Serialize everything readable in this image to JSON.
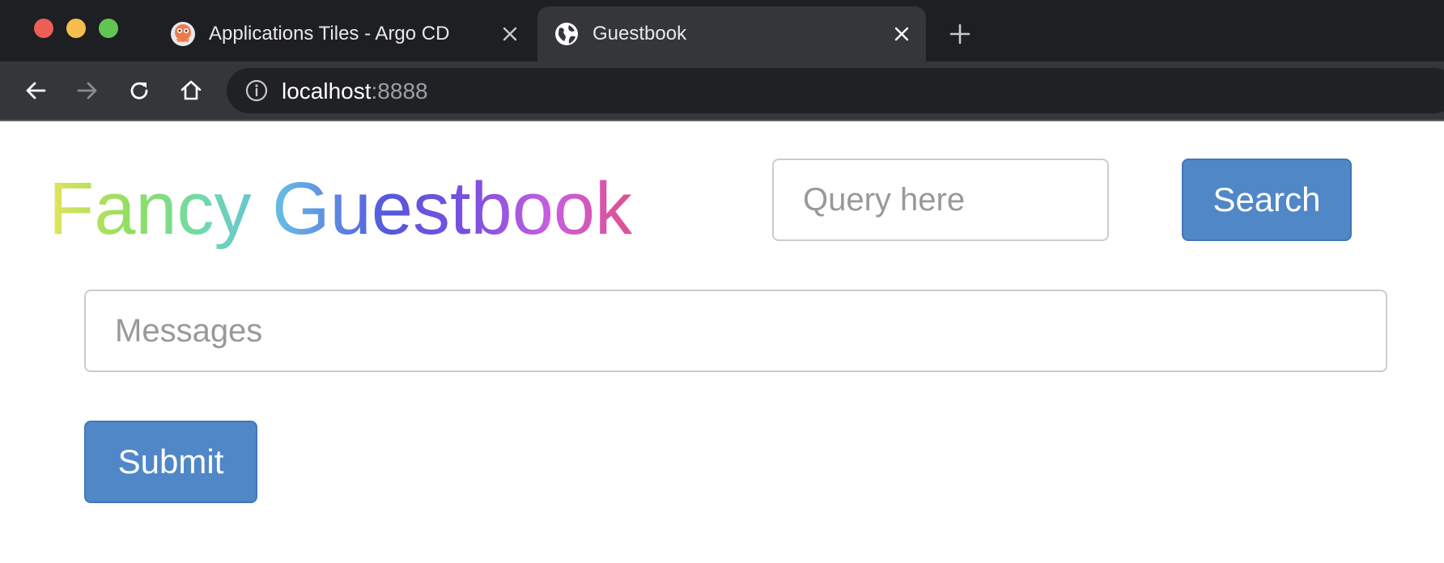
{
  "browser": {
    "tabs": [
      {
        "title": "Applications Tiles - Argo CD",
        "favicon": "argo-cd-octopus-icon",
        "active": false
      },
      {
        "title": "Guestbook",
        "favicon": "globe-icon",
        "active": true
      }
    ],
    "address_bar": {
      "host": "localhost",
      "port": ":8888"
    },
    "colors": {
      "tab_strip": "#1e1f22",
      "toolbar": "#35363a",
      "omnibox": "#202124"
    }
  },
  "page": {
    "title": "Fancy Guestbook",
    "query_input": {
      "placeholder": "Query here",
      "value": ""
    },
    "search_button": "Search",
    "messages_input": {
      "placeholder": "Messages",
      "value": ""
    },
    "submit_button": "Submit",
    "colors": {
      "button": "#5087c7",
      "input_border": "#cccccc",
      "placeholder": "#999999"
    }
  }
}
